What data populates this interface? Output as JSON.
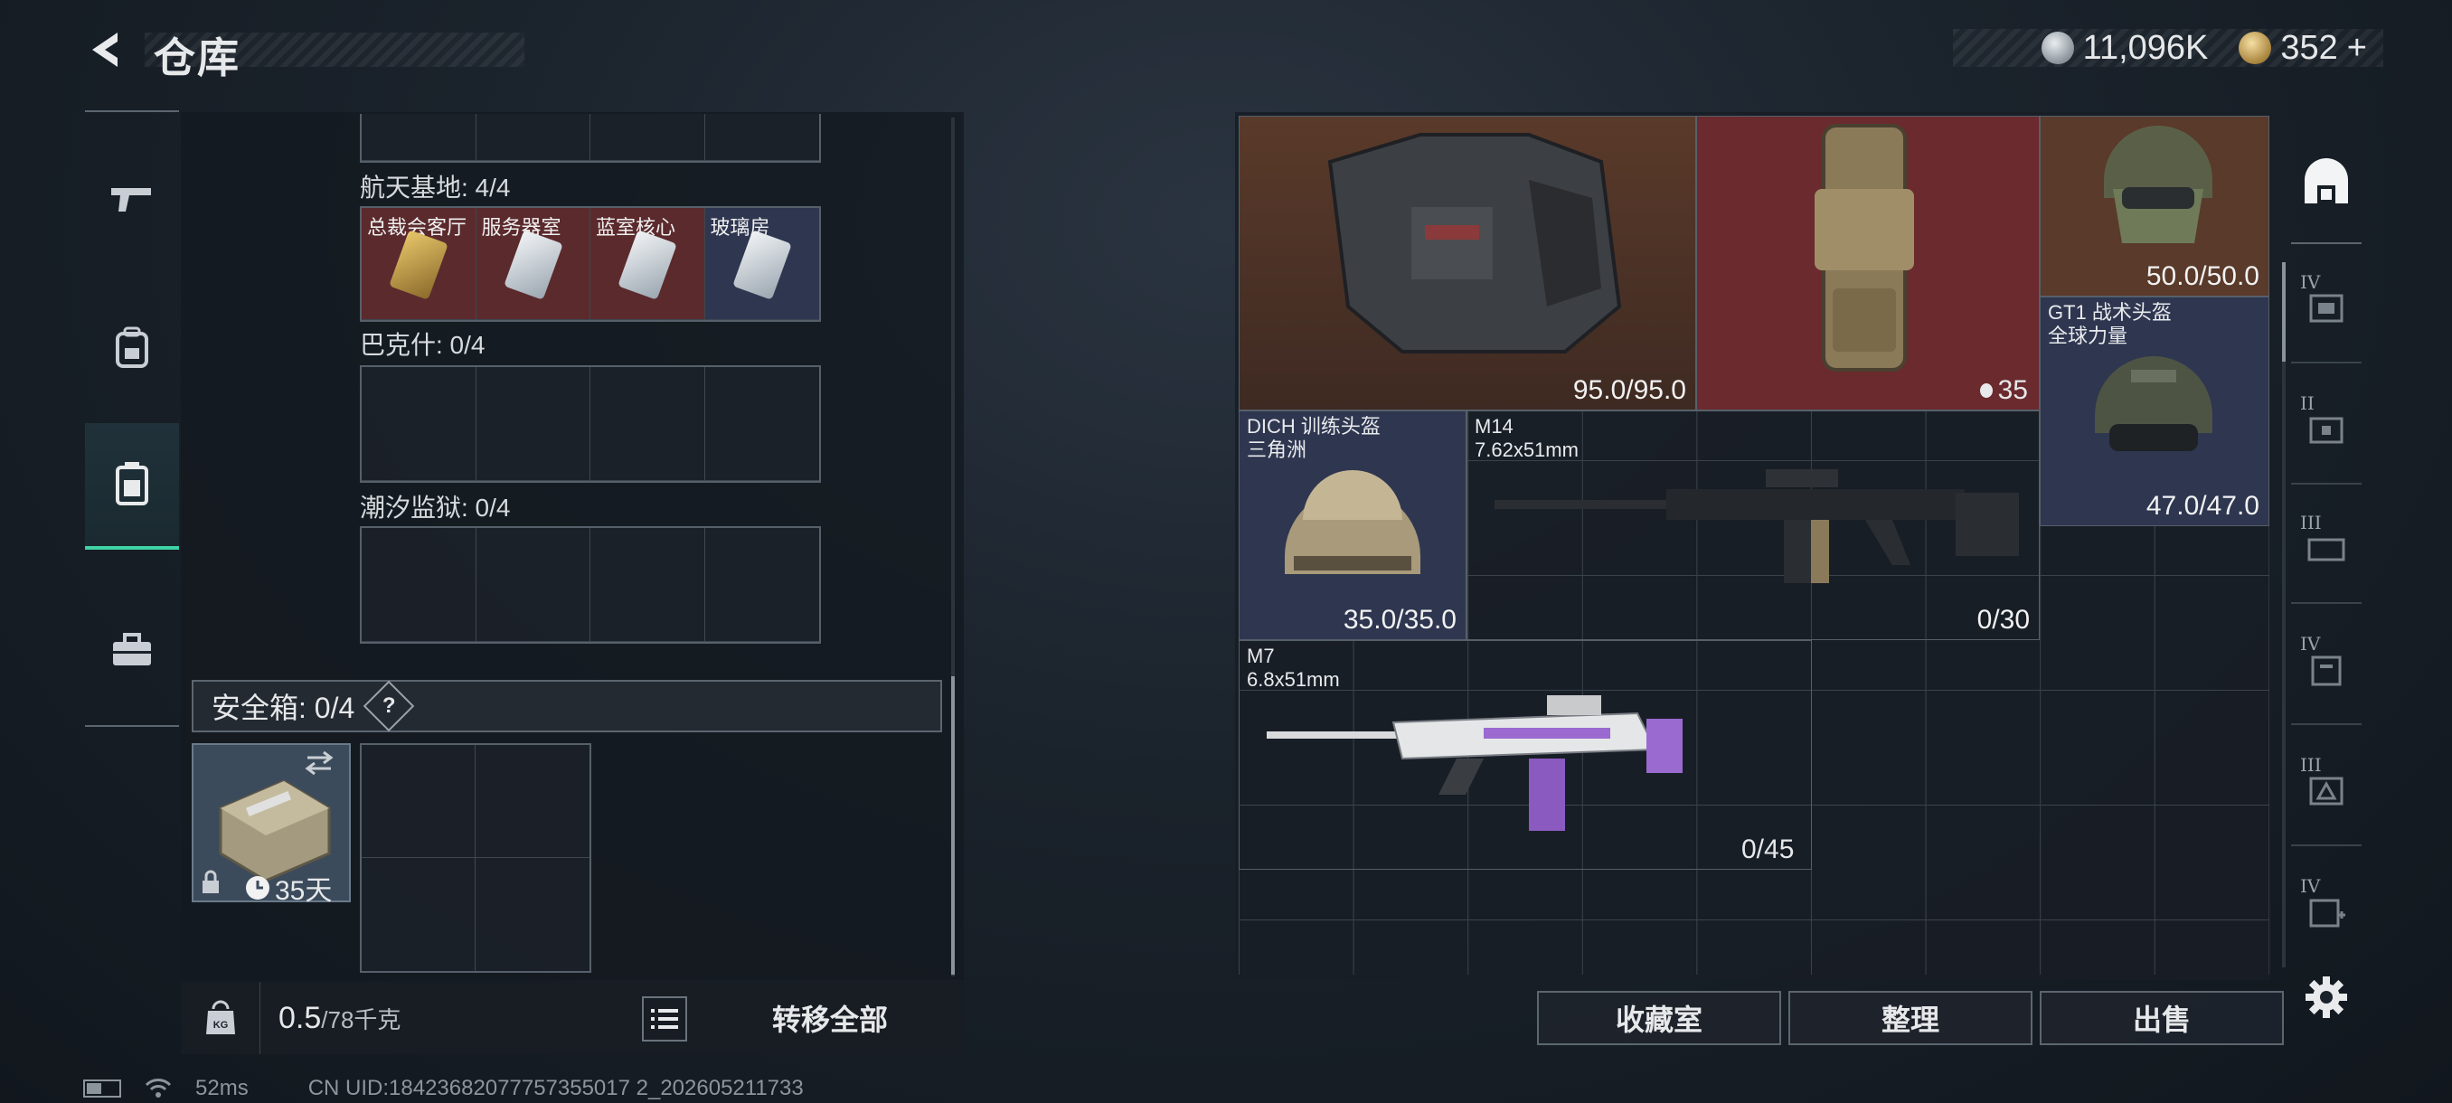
{
  "header": {
    "title": "仓库"
  },
  "currency": {
    "silver": "11,096K",
    "gold": "352",
    "gold_add": "+"
  },
  "stash": {
    "sections": [
      {
        "label": "航天基地: 4/4",
        "cards": [
          "总裁会客厅",
          "服务器室",
          "蓝室核心",
          "玻璃房"
        ]
      },
      {
        "label": "巴克什: 0/4"
      },
      {
        "label": "潮汐监狱: 0/4"
      }
    ],
    "secure_box": {
      "label": "安全箱: 0/4",
      "help": "?",
      "timer": "35天"
    },
    "weight": {
      "current": "0.5",
      "max": "/78千克"
    },
    "transfer_label": "转移全部"
  },
  "status": {
    "ping": "52ms",
    "uid": "CN UID:18423682077757355017 2_202605211733"
  },
  "inventory": {
    "items": [
      {
        "name": "",
        "durability": "95.0/95.0"
      },
      {
        "name": "",
        "count": "35"
      },
      {
        "name": "",
        "durability": "50.0/50.0"
      },
      {
        "name": "GT1 战术头盔\n全球力量",
        "durability": "47.0/47.0"
      },
      {
        "name": "DICH 训练头盔\n三角洲",
        "durability": "35.0/35.0"
      },
      {
        "name": "M14\n7.62x51mm",
        "durability": "0/30"
      },
      {
        "name": "M7\n6.8x51mm",
        "durability": "0/45"
      }
    ],
    "buttons": {
      "collection": "收藏室",
      "sort": "整理",
      "sell": "出售"
    }
  },
  "slot_tabs": [
    {
      "roman": "IV"
    },
    {
      "roman": "II"
    },
    {
      "roman": "III"
    },
    {
      "roman": "IV"
    },
    {
      "roman": "III"
    },
    {
      "roman": "IV"
    }
  ],
  "colors": {
    "accent": "#3fd3a5",
    "red_slot": "#6a2a2e",
    "blue_slot": "#2e3650",
    "gold_slot": "#5a3a2a"
  },
  "icons": [
    "back-arrow-icon",
    "weapon-icon",
    "backpack-icon",
    "chest-rig-icon",
    "toolbox-icon",
    "secure-case-icon",
    "weight-icon",
    "list-icon",
    "helmet-slot-icon",
    "settings-icon",
    "battery-icon",
    "wifi-icon"
  ]
}
